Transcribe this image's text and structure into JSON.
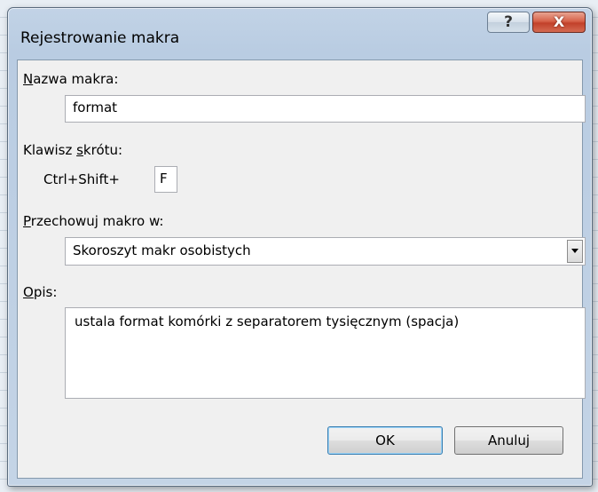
{
  "window": {
    "title": "Rejestrowanie makra",
    "help_label": "?",
    "close_label": "X"
  },
  "form": {
    "macro_name": {
      "label_underlined": "N",
      "label_rest": "azwa makra:",
      "value": "format"
    },
    "shortcut": {
      "label_pre": "Klawisz ",
      "label_underlined": "s",
      "label_rest": "krótu:",
      "prefix": "Ctrl+Shift+",
      "key_value": "F"
    },
    "store_in": {
      "label_underlined": "P",
      "label_rest": "rzechowuj makro w:",
      "selected": "Skoroszyt makr osobistych"
    },
    "description": {
      "label_underlined": "O",
      "label_rest": "pis:",
      "value": "ustala format komórki z separatorem tysięcznym (spacja)"
    }
  },
  "buttons": {
    "ok": "OK",
    "cancel": "Anuluj"
  }
}
